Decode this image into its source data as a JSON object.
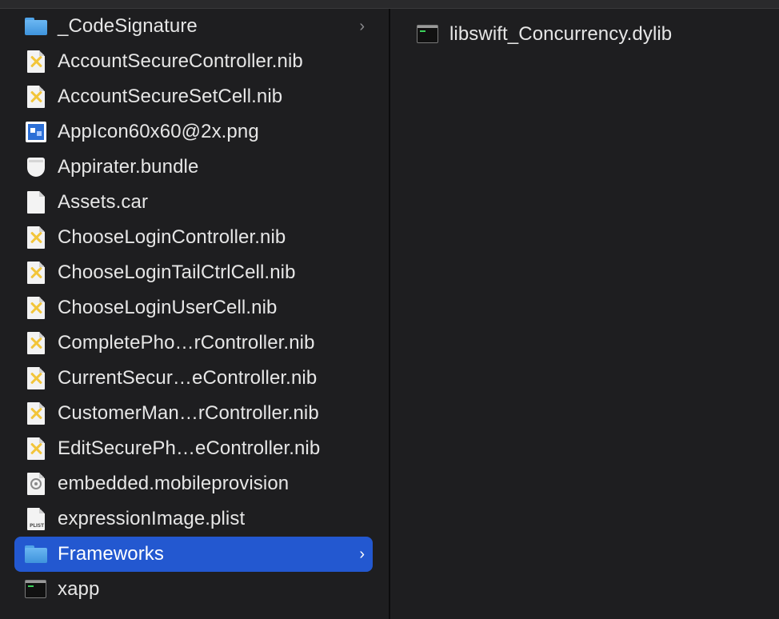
{
  "left_column": {
    "items": [
      {
        "label": "_CodeSignature",
        "icon": "folder-icon",
        "has_chevron": true,
        "chevron": "›",
        "selected": false
      },
      {
        "label": "AccountSecureController.nib",
        "icon": "nib-file-icon",
        "selected": false
      },
      {
        "label": "AccountSecureSetCell.nib",
        "icon": "nib-file-icon",
        "selected": false
      },
      {
        "label": "AppIcon60x60@2x.png",
        "icon": "png-image-icon",
        "selected": false
      },
      {
        "label": "Appirater.bundle",
        "icon": "bundle-icon",
        "selected": false
      },
      {
        "label": "Assets.car",
        "icon": "document-icon",
        "selected": false
      },
      {
        "label": "ChooseLoginController.nib",
        "icon": "nib-file-icon",
        "selected": false
      },
      {
        "label": "ChooseLoginTailCtrlCell.nib",
        "icon": "nib-file-icon",
        "selected": false
      },
      {
        "label": "ChooseLoginUserCell.nib",
        "icon": "nib-file-icon",
        "selected": false
      },
      {
        "label": "CompletePho…rController.nib",
        "icon": "nib-file-icon",
        "selected": false
      },
      {
        "label": "CurrentSecur…eController.nib",
        "icon": "nib-file-icon",
        "selected": false
      },
      {
        "label": "CustomerMan…rController.nib",
        "icon": "nib-file-icon",
        "selected": false
      },
      {
        "label": "EditSecurePh…eController.nib",
        "icon": "nib-file-icon",
        "selected": false
      },
      {
        "label": "embedded.mobileprovision",
        "icon": "provision-gear-icon",
        "selected": false
      },
      {
        "label": "expressionImage.plist",
        "icon": "plist-file-icon",
        "icon_text": "PLIST",
        "selected": false
      },
      {
        "label": "Frameworks",
        "icon": "folder-icon",
        "has_chevron": true,
        "chevron": "›",
        "selected": true
      },
      {
        "label": "xapp",
        "icon": "executable-icon",
        "selected": false
      }
    ]
  },
  "right_column": {
    "items": [
      {
        "label": "libswift_Concurrency.dylib",
        "icon": "executable-icon"
      }
    ]
  },
  "colors": {
    "background": "#1e1e20",
    "selection": "#2358d0",
    "text": "#e6e6e6",
    "folder": "#4fa3e8",
    "nib_accent": "#f2c53a"
  }
}
